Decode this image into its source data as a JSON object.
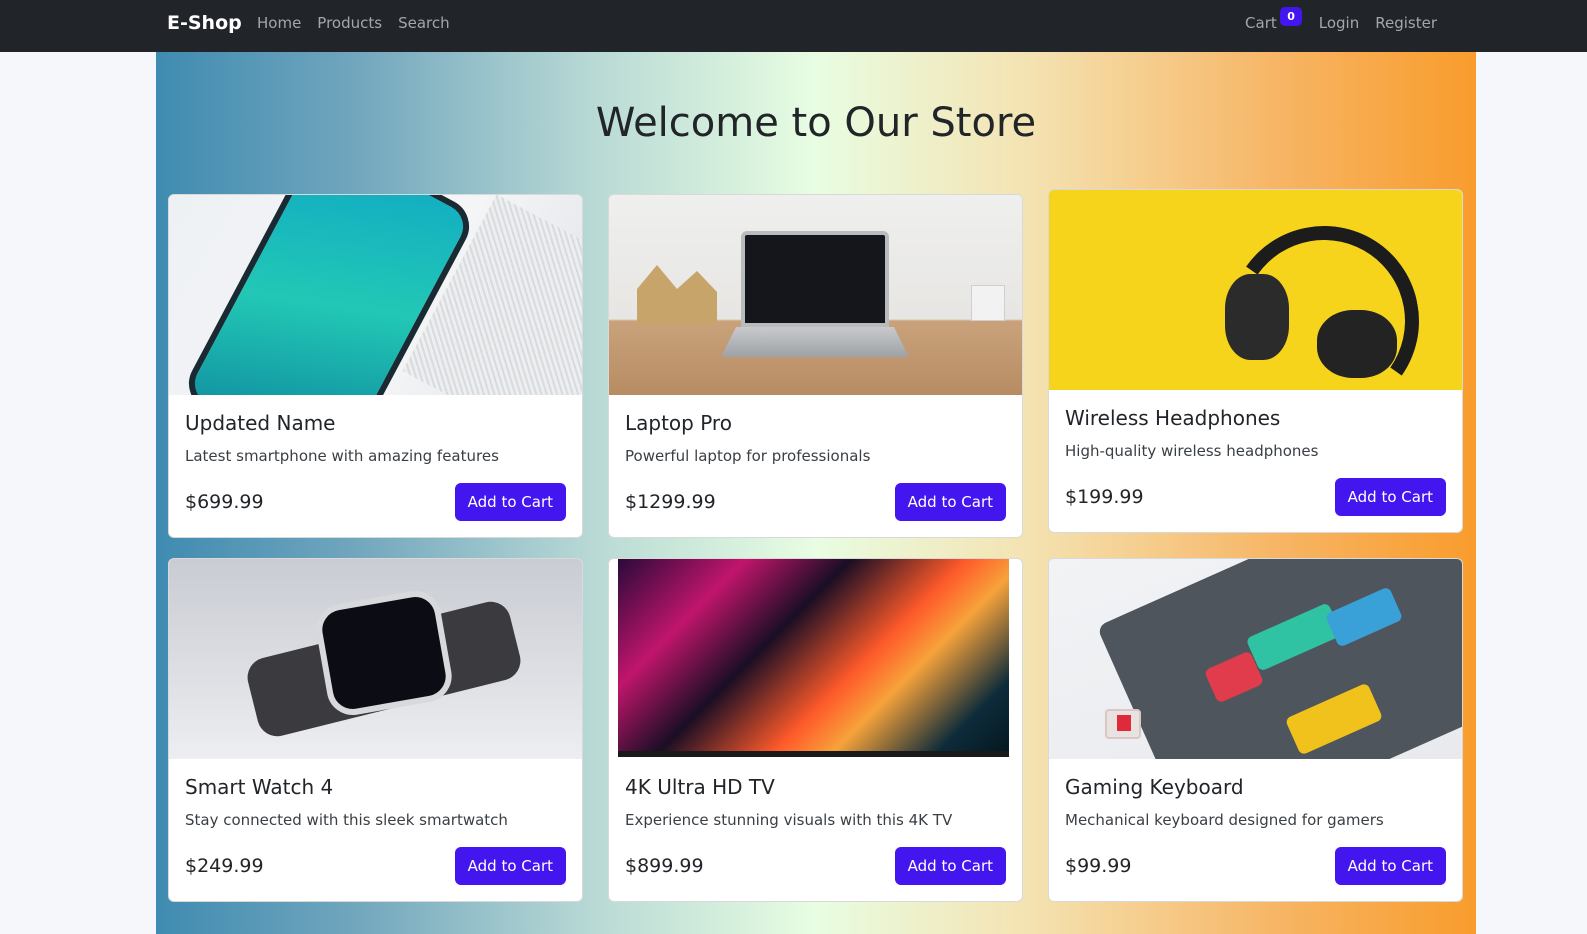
{
  "navbar": {
    "brand": "E-Shop",
    "links": [
      "Home",
      "Products",
      "Search"
    ],
    "cart_label": "Cart",
    "cart_count": "0",
    "login_label": "Login",
    "register_label": "Register"
  },
  "hero": {
    "title": "Welcome to Our Store"
  },
  "products": [
    {
      "name": "Updated Name",
      "description": "Latest smartphone with amazing features",
      "price": "$699.99",
      "button": "Add to Cart",
      "image_icon": "smartphone-image"
    },
    {
      "name": "Laptop Pro",
      "description": "Powerful laptop for professionals",
      "price": "$1299.99",
      "button": "Add to Cart",
      "image_icon": "laptop-image"
    },
    {
      "name": "Wireless Headphones",
      "description": "High-quality wireless headphones",
      "price": "$199.99",
      "button": "Add to Cart",
      "image_icon": "headphones-image"
    },
    {
      "name": "Smart Watch 4",
      "description": "Stay connected with this sleek smartwatch",
      "price": "$249.99",
      "button": "Add to Cart",
      "image_icon": "smartwatch-image"
    },
    {
      "name": "4K Ultra HD TV",
      "description": "Experience stunning visuals with this 4K TV",
      "price": "$899.99",
      "button": "Add to Cart",
      "image_icon": "tv-image"
    },
    {
      "name": "Gaming Keyboard",
      "description": "Mechanical keyboard designed for gamers",
      "price": "$99.99",
      "button": "Add to Cart",
      "image_icon": "keyboard-image"
    }
  ],
  "colors": {
    "navbar_bg": "#212529",
    "accent": "#4316f0"
  }
}
